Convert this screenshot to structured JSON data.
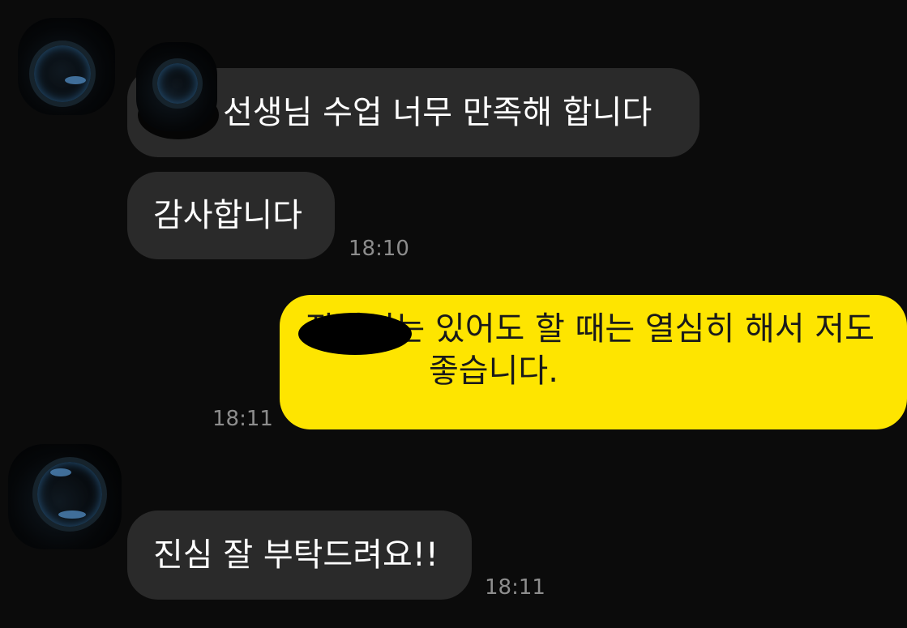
{
  "messages": [
    {
      "direction": "incoming",
      "text": "선생님 수업 너무 만족해 합니다",
      "time": ""
    },
    {
      "direction": "incoming",
      "text": "감사합니다",
      "time": "18:10"
    },
    {
      "direction": "outgoing",
      "text": "장난기는 있어도 할 때는 열심히 해서 저도 좋습니다.",
      "time": "18:11"
    },
    {
      "direction": "incoming",
      "text": "진심 잘 부탁드려요!!",
      "time": "18:11"
    }
  ],
  "colors": {
    "background": "#0b0b0b",
    "incoming_bubble": "#2a2a2a",
    "outgoing_bubble": "#fee500",
    "timestamp": "#8d8d8d"
  },
  "icons": {
    "sender_avatar": "avatar-icon"
  }
}
